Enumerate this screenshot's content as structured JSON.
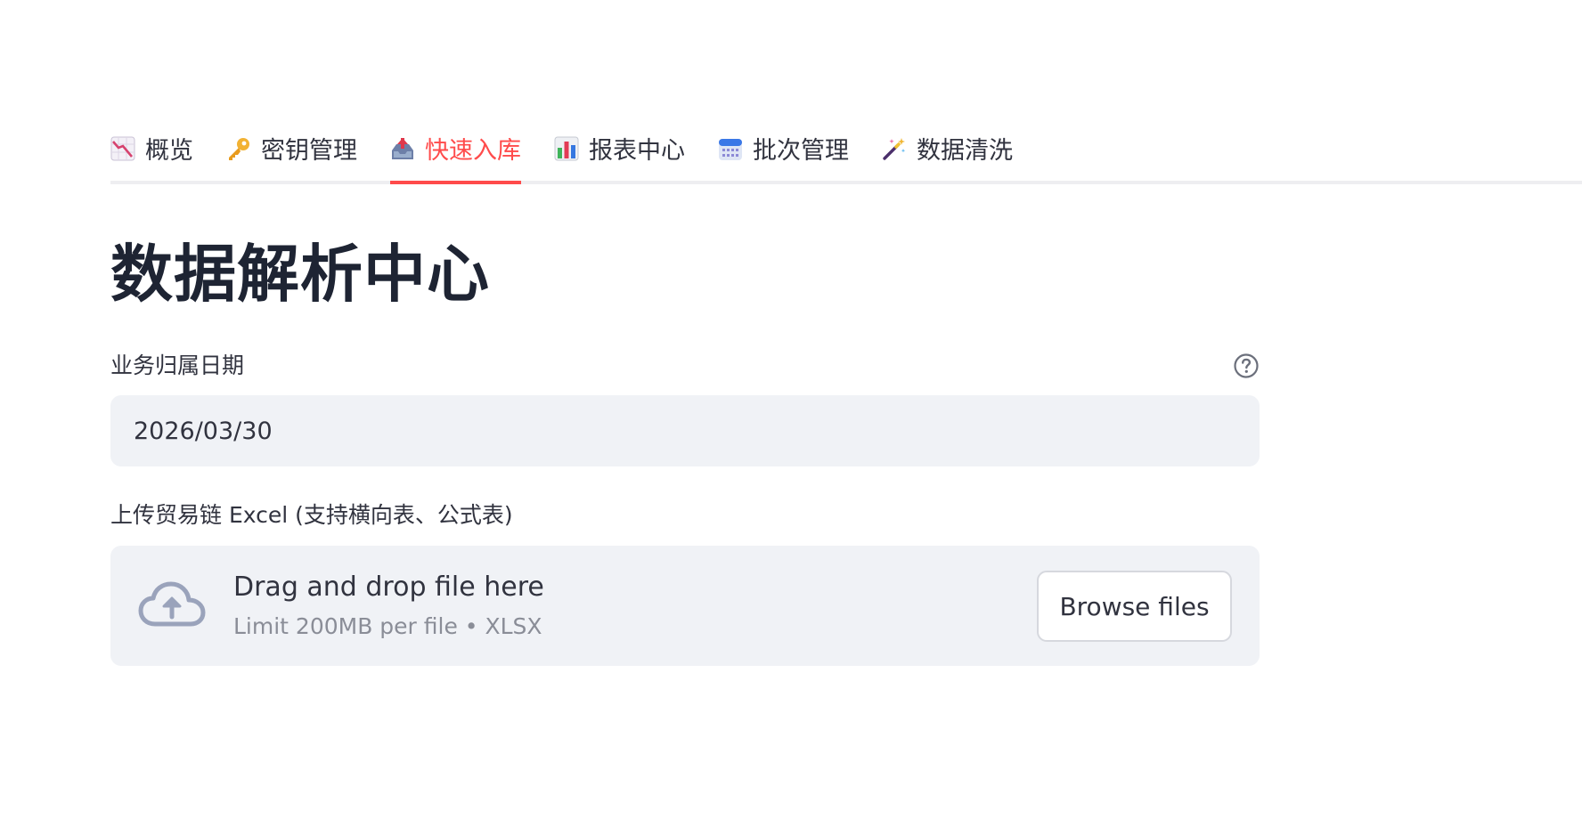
{
  "tabs": [
    {
      "label": "概览",
      "icon": "chart-decreasing-icon",
      "active": false
    },
    {
      "label": "密钥管理",
      "icon": "key-icon",
      "active": false
    },
    {
      "label": "快速入库",
      "icon": "inbox-tray-icon",
      "active": true
    },
    {
      "label": "报表中心",
      "icon": "bar-chart-icon",
      "active": false
    },
    {
      "label": "批次管理",
      "icon": "calendar-icon",
      "active": false
    },
    {
      "label": "数据清洗",
      "icon": "magic-wand-icon",
      "active": false
    }
  ],
  "page": {
    "title": "数据解析中心"
  },
  "date_field": {
    "label": "业务归属日期",
    "value": "2026/03/30",
    "help_icon": "question-circle-icon"
  },
  "upload": {
    "label": "上传贸易链 Excel (支持横向表、公式表)",
    "icon": "cloud-upload-icon",
    "title": "Drag and drop file here",
    "subtitle": "Limit 200MB per file • XLSX",
    "button_label": "Browse files"
  },
  "colors": {
    "accent": "#ff4b4b",
    "field_background": "#f0f2f6",
    "title_text": "#1e2433",
    "muted_text": "#8a8d97"
  }
}
